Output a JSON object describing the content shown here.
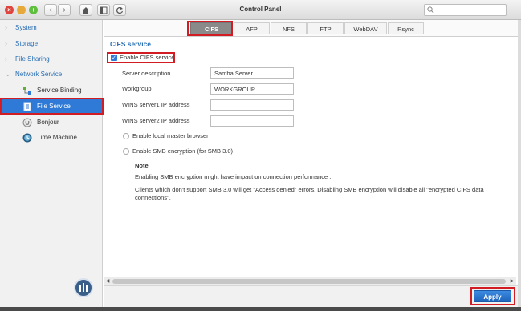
{
  "window": {
    "title": "Control Panel"
  },
  "sidebar": {
    "items": [
      {
        "label": "System"
      },
      {
        "label": "Storage"
      },
      {
        "label": "File Sharing"
      },
      {
        "label": "Network Service"
      }
    ],
    "subitems": [
      {
        "label": "Service Binding",
        "icon": "service-binding-icon"
      },
      {
        "label": "File Service",
        "icon": "file-service-icon",
        "active": true
      },
      {
        "label": "Bonjour",
        "icon": "bonjour-icon"
      },
      {
        "label": "Time Machine",
        "icon": "time-machine-icon"
      }
    ]
  },
  "tabs": [
    {
      "label": "CIFS",
      "active": true
    },
    {
      "label": "AFP"
    },
    {
      "label": "NFS"
    },
    {
      "label": "FTP"
    },
    {
      "label": "WebDAV"
    },
    {
      "label": "Rsync"
    }
  ],
  "cifs": {
    "section_title": "CIFS service",
    "enable_label": "Enable CIFS service",
    "enable_checked": true,
    "fields": [
      {
        "label": "Server description",
        "value": "Samba Server"
      },
      {
        "label": "Workgroup",
        "value": "WORKGROUP"
      },
      {
        "label": "WINS server1 IP address",
        "value": ""
      },
      {
        "label": "WINS server2 IP address",
        "value": ""
      }
    ],
    "local_master_label": "Enable local master browser",
    "smb_encryption_label": "Enable SMB encryption (for SMB 3.0)",
    "note_title": "Note",
    "note_line1": "Enabling SMB encryption might have impact on connection performance .",
    "note_line2": "Clients which don't support SMB 3.0 will get \"Access denied\" errors. Disabling SMB encryption will disable all \"encrypted CIFS data connections\"."
  },
  "footer": {
    "apply_label": "Apply"
  },
  "colors": {
    "accent": "#2f7ad6",
    "highlight": "#d11c24",
    "link": "#2a6fb5"
  }
}
